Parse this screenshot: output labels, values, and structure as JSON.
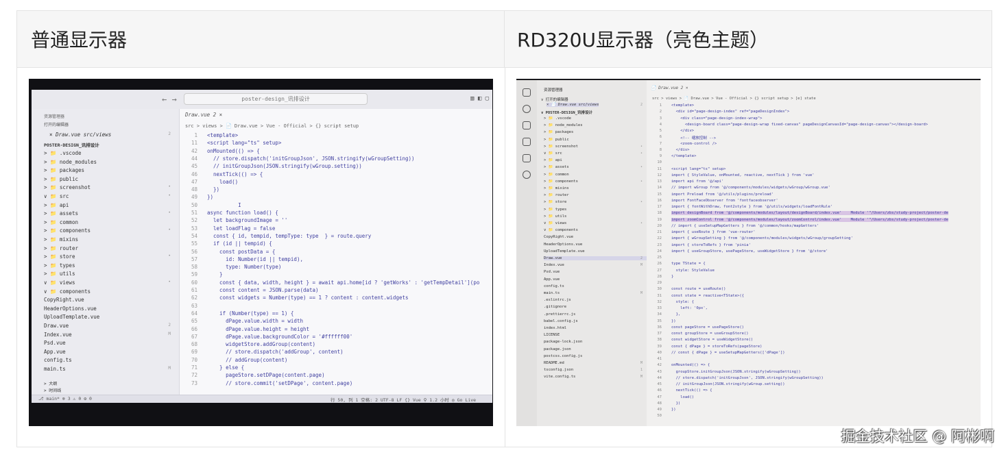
{
  "table": {
    "col1_header": "普通显示器",
    "col2_header": "RD320U显示器（亮色主题）"
  },
  "photo1": {
    "search": "poster-design_讯排设计",
    "nav": "← →",
    "explorer_title": "资源管理器",
    "open_editors": "打开的编辑器",
    "open_file": "× Draw.vue src/views",
    "open_file_badge": "2",
    "project": "POSTER-DESIGN_讯排设计",
    "tree": [
      {
        "label": "> 📁 .vscode",
        "badge": ""
      },
      {
        "label": "> 📁 node_modules",
        "badge": ""
      },
      {
        "label": "> 📁 packages",
        "badge": ""
      },
      {
        "label": "> 📁 public",
        "badge": ""
      },
      {
        "label": "> 📁 screenshot",
        "badge": "•"
      },
      {
        "label": "∨ 📁 src",
        "badge": "•"
      },
      {
        "label": "  > 📁 api",
        "badge": ""
      },
      {
        "label": "  > 📁 assets",
        "badge": "•"
      },
      {
        "label": "  > 📁 common",
        "badge": ""
      },
      {
        "label": "  > 📁 components",
        "badge": "•"
      },
      {
        "label": "  > 📁 mixins",
        "badge": ""
      },
      {
        "label": "  > 📁 router",
        "badge": ""
      },
      {
        "label": "  > 📁 store",
        "badge": "•"
      },
      {
        "label": "  > 📁 types",
        "badge": ""
      },
      {
        "label": "  > 📁 utils",
        "badge": ""
      },
      {
        "label": "  ∨ 📁 views",
        "badge": "•"
      },
      {
        "label": "    ∨ 📁 components",
        "badge": ""
      },
      {
        "label": "       CopyRight.vue",
        "badge": ""
      },
      {
        "label": "       HeaderOptions.vue",
        "badge": ""
      },
      {
        "label": "       UploadTemplate.vue",
        "badge": ""
      },
      {
        "label": "     Draw.vue",
        "badge": "2"
      },
      {
        "label": "     Index.vue",
        "badge": "M"
      },
      {
        "label": "     Psd.vue",
        "badge": ""
      },
      {
        "label": "    App.vue",
        "badge": ""
      },
      {
        "label": "    config.ts",
        "badge": ""
      },
      {
        "label": "    main.ts",
        "badge": "M"
      }
    ],
    "outline": "> 大纲",
    "timeline": "> 时间线",
    "npm": "> NPM 脚本",
    "tab": "Draw.vue 2 ×",
    "breadcrumb": "src > views > 📄 Draw.vue > Vue - Official > {} script setup",
    "lines": [
      {
        "n": "1",
        "c": "<template>"
      },
      {
        "n": "11",
        "c": "<script lang=\"ts\" setup>"
      },
      {
        "n": "42",
        "c": "onMounted(() => {"
      },
      {
        "n": "44",
        "c": "  // store.dispatch('initGroupJson', JSON.stringify(wGroupSetting))"
      },
      {
        "n": "45",
        "c": "  // initGroupJson(JSON.stringify(wGroup.setting))"
      },
      {
        "n": "46",
        "c": "  nextTick(() => {"
      },
      {
        "n": "47",
        "c": "    load()"
      },
      {
        "n": "48",
        "c": "  })"
      },
      {
        "n": "49",
        "c": "})"
      },
      {
        "n": "50",
        "c": "          I"
      },
      {
        "n": "51",
        "c": "async function load() {"
      },
      {
        "n": "52",
        "c": "  let backgroundImage = ''"
      },
      {
        "n": "53",
        "c": "  let loadFlag = false"
      },
      {
        "n": "54",
        "c": "  const { id, tempid, tempType: type  } = route.query"
      },
      {
        "n": "55",
        "c": "  if (id || tempid) {"
      },
      {
        "n": "56",
        "c": "    const postData = {"
      },
      {
        "n": "57",
        "c": "      id: Number(id || tempid),"
      },
      {
        "n": "58",
        "c": "      type: Number(type)"
      },
      {
        "n": "59",
        "c": "    }"
      },
      {
        "n": "60",
        "c": "    const { data, width, height } = await api.home[id ? 'getWorks' : 'getTempDetail'](po"
      },
      {
        "n": "61",
        "c": "    const content = JSON.parse(data)"
      },
      {
        "n": "62",
        "c": "    const widgets = Number(type) == 1 ? content : content.widgets"
      },
      {
        "n": "63",
        "c": ""
      },
      {
        "n": "64",
        "c": "    if (Number(type) == 1) {"
      },
      {
        "n": "65",
        "c": "      dPage.value.width = width"
      },
      {
        "n": "66",
        "c": "      dPage.value.height = height"
      },
      {
        "n": "67",
        "c": "      dPage.value.backgroundColor = '#ffffff00'"
      },
      {
        "n": "68",
        "c": "      widgetStore.addGroup(content)"
      },
      {
        "n": "69",
        "c": "      // store.dispatch('addGroup', content)"
      },
      {
        "n": "70",
        "c": "      // addGroup(content)"
      },
      {
        "n": "71",
        "c": "    } else {"
      },
      {
        "n": "72",
        "c": "      pageStore.setDPage(content.page)"
      },
      {
        "n": "73",
        "c": "      // store.commit('setDPage', content.page)"
      }
    ],
    "status_left": "⎇ main*  ⊗ 3 ⚠ 0   ⚙ 0",
    "status_right": "行 50, 列 1   空格: 2   UTF-8   LF   {} Vue   ⚲ 1.2 小时   ◎ Go Live"
  },
  "photo2": {
    "explorer_title": "资源管理器",
    "open_editors": "∨ 打开的编辑器",
    "open_file": "× 📄 Draw.vue src/views",
    "open_file_badge": "2",
    "project": "∨ POSTER-DESIGN_讯排设计",
    "tree": [
      {
        "label": "> 📁 .vscode",
        "badge": ""
      },
      {
        "label": "> 📁 node_modules",
        "badge": ""
      },
      {
        "label": "> 📁 packages",
        "badge": ""
      },
      {
        "label": "> 📁 public",
        "badge": ""
      },
      {
        "label": "> 📁 screenshot",
        "badge": "•"
      },
      {
        "label": "∨ 📁 src",
        "badge": "•"
      },
      {
        "label": "  > 📁 api",
        "badge": ""
      },
      {
        "label": "  > 📁 assets",
        "badge": "•"
      },
      {
        "label": "  > 📁 common",
        "badge": ""
      },
      {
        "label": "  > 📁 components",
        "badge": "•"
      },
      {
        "label": "  > 📁 mixins",
        "badge": ""
      },
      {
        "label": "  > 📁 router",
        "badge": ""
      },
      {
        "label": "  > 📁 store",
        "badge": "•"
      },
      {
        "label": "  > 📁 types",
        "badge": ""
      },
      {
        "label": "  > 📁 utils",
        "badge": ""
      },
      {
        "label": "  ∨ 📁 views",
        "badge": "•"
      },
      {
        "label": "    ∨ 📁 components",
        "badge": ""
      },
      {
        "label": "       CopyRight.vue",
        "badge": ""
      },
      {
        "label": "       HeaderOptions.vue",
        "badge": ""
      },
      {
        "label": "       UploadTemplate.vue",
        "badge": ""
      },
      {
        "label": "     Draw.vue",
        "badge": "2"
      },
      {
        "label": "     Index.vue",
        "badge": "M"
      },
      {
        "label": "     Psd.vue",
        "badge": ""
      },
      {
        "label": "    App.vue",
        "badge": ""
      },
      {
        "label": "    config.ts",
        "badge": ""
      },
      {
        "label": "    main.ts",
        "badge": "M"
      },
      {
        "label": "  .eslintrc.js",
        "badge": ""
      },
      {
        "label": "  .gitignore",
        "badge": ""
      },
      {
        "label": "  .prettierrc.js",
        "badge": ""
      },
      {
        "label": "  babel.config.js",
        "badge": ""
      },
      {
        "label": "  index.html",
        "badge": ""
      },
      {
        "label": "  LICENSE",
        "badge": ""
      },
      {
        "label": "  package-lock.json",
        "badge": ""
      },
      {
        "label": "  package.json",
        "badge": ""
      },
      {
        "label": "  postcss.config.js",
        "badge": ""
      },
      {
        "label": "  README.md",
        "badge": "M"
      },
      {
        "label": "  tsconfig.json",
        "badge": "1"
      },
      {
        "label": "  vite.config.ts",
        "badge": "M"
      }
    ],
    "tab": "📄 Draw.vue 2 ×",
    "breadcrumb": "src > views > 📄 Draw.vue > Vue - Official > {} script setup > [e] state",
    "lines": [
      {
        "n": "1",
        "c": "<template>"
      },
      {
        "n": "2",
        "c": "  <div id=\"page-design-index\" ref=\"pageDesignIndex\">"
      },
      {
        "n": "3",
        "c": "    <div class=\"page-design-index-wrap\">"
      },
      {
        "n": "4",
        "c": "      <design-board class=\"page-design-wrap fixed-canvas\" pageDesignCanvasId=\"page-design-canvas\"></design-board>"
      },
      {
        "n": "5",
        "c": "    </div>"
      },
      {
        "n": "6",
        "c": "    <!-- 缩放控制 -->"
      },
      {
        "n": "7",
        "c": "    <zoom-control />"
      },
      {
        "n": "8",
        "c": "  </div>"
      },
      {
        "n": "9",
        "c": "</template>"
      },
      {
        "n": "10",
        "c": ""
      },
      {
        "n": "11",
        "c": "<script lang=\"ts\" setup>"
      },
      {
        "n": "12",
        "c": "import { StyleValue, onMounted, reactive, nextTick } from 'vue'"
      },
      {
        "n": "13",
        "c": "import api from '@/api'"
      },
      {
        "n": "14",
        "c": "// import wGroup from '@/components/modules/widgets/wGroup/wGroup.vue'"
      },
      {
        "n": "15",
        "c": "import Preload from '@/utils/plugins/preload'"
      },
      {
        "n": "16",
        "c": "import FontFaceObserver from 'fontfaceobserver'"
      },
      {
        "n": "17",
        "c": "import { fontWithDraw, font2style } from '@/utils/widgets/loadFontRule'"
      },
      {
        "n": "18",
        "c": "import designBoard from '@/components/modules/layout/designBoard/index.vue'    Module '\"/Users/zbs/study-project/poster-de"
      },
      {
        "n": "19",
        "c": "import zoomControl from '@/components/modules/layout/zoomControl/index.vue'    Module '\"/Users/zbs/study-project/poster-de"
      },
      {
        "n": "20",
        "c": "// import { useSetupMapGetters } from '@/common/hooks/mapGetters'"
      },
      {
        "n": "21",
        "c": "import { useRoute } from 'vue-router'"
      },
      {
        "n": "22",
        "c": "import { wGroupSetting } from '@/components/modules/widgets/wGroup/groupSetting'"
      },
      {
        "n": "23",
        "c": "import { storeToRefs } from 'pinia'"
      },
      {
        "n": "24",
        "c": "import { useGroupStore, usePageStore, useWidgetStore } from '@/store'"
      },
      {
        "n": "25",
        "c": ""
      },
      {
        "n": "26",
        "c": "type TState = {"
      },
      {
        "n": "27",
        "c": "  style: StyleValue"
      },
      {
        "n": "28",
        "c": "}"
      },
      {
        "n": "29",
        "c": ""
      },
      {
        "n": "30",
        "c": "const route = useRoute()"
      },
      {
        "n": "31",
        "c": "const state = reactive<TState>({"
      },
      {
        "n": "32",
        "c": "  style: {"
      },
      {
        "n": "33",
        "c": "    left: '0px',"
      },
      {
        "n": "34",
        "c": "  },"
      },
      {
        "n": "35",
        "c": "})"
      },
      {
        "n": "36",
        "c": "const pageStore = usePageStore()"
      },
      {
        "n": "37",
        "c": "const groupStore = useGroupStore()"
      },
      {
        "n": "38",
        "c": "const widgetStore = useWidgetStore()"
      },
      {
        "n": "39",
        "c": "const { dPage } = storeToRefs(pageStore)"
      },
      {
        "n": "40",
        "c": "// const { dPage } = useSetupMapGetters(['dPage'])"
      },
      {
        "n": "41",
        "c": ""
      },
      {
        "n": "42",
        "c": "onMounted(() => {"
      },
      {
        "n": "43",
        "c": "  groupStore.initGroupJson(JSON.stringify(wGroupSetting))"
      },
      {
        "n": "44",
        "c": "  // store.dispatch('initGroupJson', JSON.stringify(wGroupSetting))"
      },
      {
        "n": "45",
        "c": "  // initGroupJson(JSON.stringify(wGroup.setting))"
      },
      {
        "n": "46",
        "c": "  nextTick(() => {"
      },
      {
        "n": "47",
        "c": "    load()"
      },
      {
        "n": "48",
        "c": "  })"
      },
      {
        "n": "49",
        "c": "})"
      },
      {
        "n": "50",
        "c": ""
      }
    ]
  },
  "watermark": "掘金技术社区 @ 阿彬啊"
}
